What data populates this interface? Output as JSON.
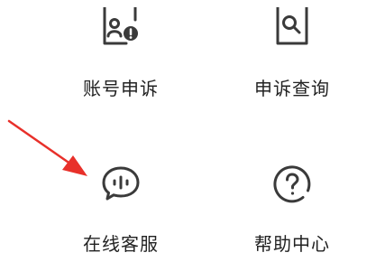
{
  "grid": {
    "items": [
      {
        "label": "账号申诉",
        "icon": "account-appeal-icon"
      },
      {
        "label": "申诉查询",
        "icon": "appeal-search-icon"
      },
      {
        "label": "在线客服",
        "icon": "online-service-icon"
      },
      {
        "label": "帮助中心",
        "icon": "help-center-icon"
      }
    ]
  },
  "colors": {
    "icon_stroke": "#3a3a3a",
    "label_text": "#222222",
    "arrow": "#e8302a"
  }
}
